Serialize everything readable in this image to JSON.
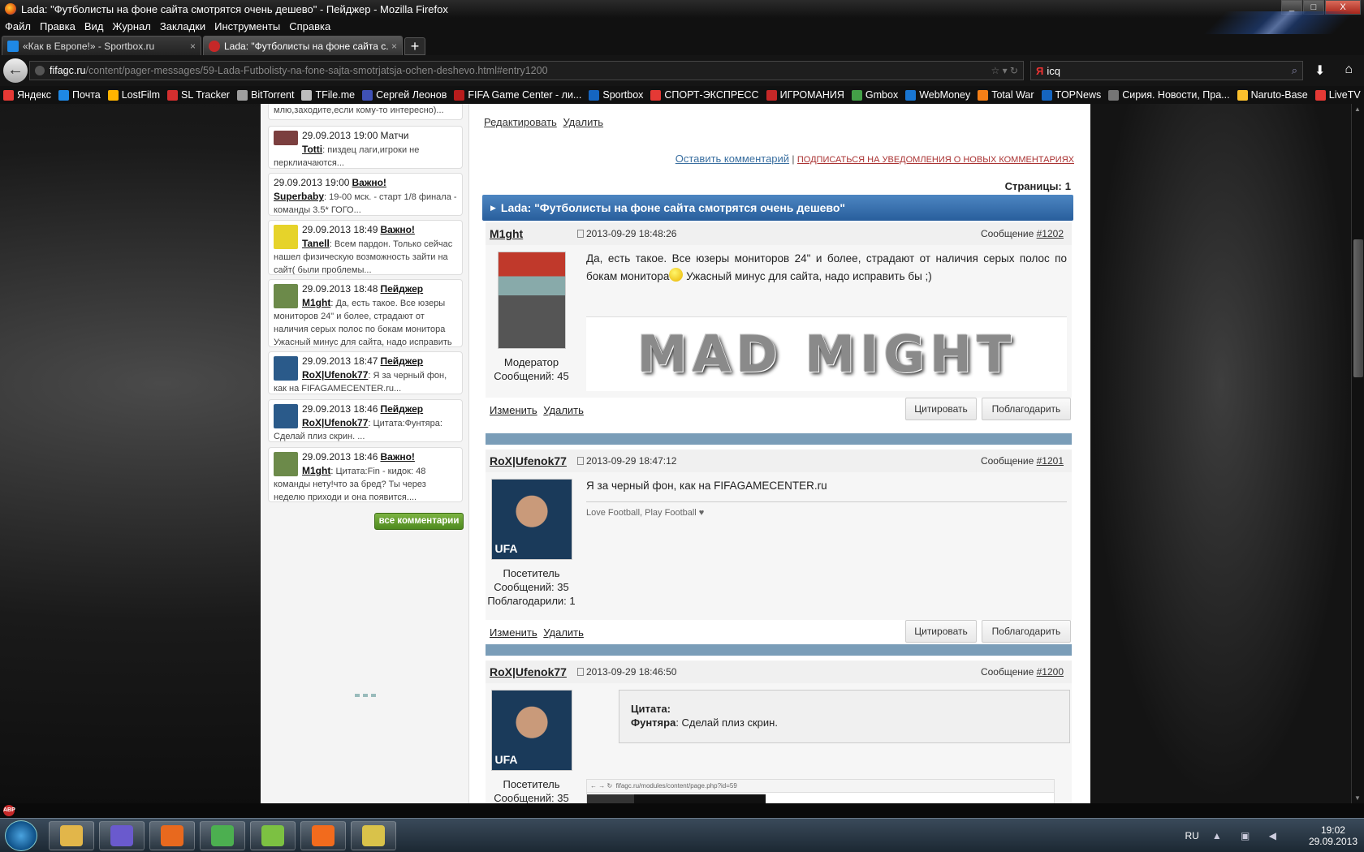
{
  "window": {
    "title": "Lada: \"Футболисты на фоне сайта смотрятся очень дешево\" - Пейджер - Mozilla Firefox",
    "controls": [
      "_",
      "□",
      "X"
    ]
  },
  "menu": [
    "Файл",
    "Правка",
    "Вид",
    "Журнал",
    "Закладки",
    "Инструменты",
    "Справка"
  ],
  "tabs": [
    {
      "label": "«Как в Европе!» - Sportbox.ru",
      "close": "×",
      "icon_color": "#1e88e5"
    },
    {
      "label": "Lada: \"Футболисты на фоне сайта с...",
      "close": "×",
      "icon_color": "#c62828"
    }
  ],
  "new_tab": "+",
  "address": {
    "domain": "fifagc.ru",
    "path": "/content/pager-messages/59-Lada-Futbolisty-na-fone-sajta-smotrjatsja-ochen-deshevo.html#entry1200",
    "controls": "☆ ▾ ↻"
  },
  "search": {
    "engine": "Я",
    "value": "icq",
    "icon": "search-icon"
  },
  "bookmarks": [
    {
      "label": "Яндекс",
      "color": "#e53935"
    },
    {
      "label": "Почта",
      "color": "#1e88e5"
    },
    {
      "label": "LostFilm",
      "color": "#ffb300"
    },
    {
      "label": "SL Tracker",
      "color": "#d32f2f"
    },
    {
      "label": "BitTorrent",
      "color": "#9e9e9e"
    },
    {
      "label": "TFile.me",
      "color": "#bdbdbd"
    },
    {
      "label": "Сергей Леонов",
      "color": "#3f51b5"
    },
    {
      "label": "FIFA Game Center - ли...",
      "color": "#b71c1c"
    },
    {
      "label": "Sportbox",
      "color": "#1565c0"
    },
    {
      "label": "СПОРТ-ЭКСПРЕСС",
      "color": "#e53935"
    },
    {
      "label": "ИГРОМАНИЯ",
      "color": "#c62828"
    },
    {
      "label": "Gmbox",
      "color": "#43a047"
    },
    {
      "label": "WebMoney",
      "color": "#1976d2"
    },
    {
      "label": "Total War",
      "color": "#f57f17"
    },
    {
      "label": "TOPNews",
      "color": "#1565c0"
    },
    {
      "label": "Сирия. Новости, Пра...",
      "color": "#757575"
    },
    {
      "label": "Naruto-Base",
      "color": "#fbc02d"
    },
    {
      "label": "LiveTV",
      "color": "#e53935"
    }
  ],
  "sidebar": {
    "comments": [
      {
        "text": "млю,заходите,если кому-то интересно)..."
      },
      {
        "date": "29.09.2013 19:00",
        "category": "Матчи",
        "author": "Totti",
        "text": "пиздец лаги,игроки не перклиачаются...",
        "avatar_color": "#7b3f3f"
      },
      {
        "date": "29.09.2013 19:00",
        "category": "Важно!",
        "author": "Superbaby",
        "text": "19-00 мск. - старт 1/8 финала - команды 3.5* ГОГО..."
      },
      {
        "date": "29.09.2013 18:49",
        "category": "Важно!",
        "author": "Tanell",
        "text": "Всем пардон. Только сейчас нашел физическую возможность зайти на сайт( были проблемы...",
        "avatar_color": "#e6d32a"
      },
      {
        "date": "29.09.2013 18:48",
        "category": "Пейджер",
        "author": "M1ght",
        "text": "Да, есть такое. Все юзеры мониторов 24\" и более, страдают от наличия серых полос по бокам монитора Ужасный минус для сайта, надо исправить бы ;)...",
        "avatar_color": "#6c8a4a"
      },
      {
        "date": "29.09.2013 18:47",
        "category": "Пейджер",
        "author": "RoX|Ufenok77",
        "text": "Я за черный фон, как на FIFAGAMECENTER.ru...",
        "avatar_color": "#2a5a8a"
      },
      {
        "date": "29.09.2013 18:46",
        "category": "Пейджер",
        "author": "RoX|Ufenok77",
        "text": "Цитата:Фунтяра: Сделай плиз скрин. ...",
        "avatar_color": "#2a5a8a"
      },
      {
        "date": "29.09.2013 18:46",
        "category": "Важно!",
        "author": "M1ght",
        "text": "Цитата:Fin - кидок: 48 команды нету!что за бред? Ты через неделю приходи и она появится....",
        "avatar_color": "#6c8a4a"
      }
    ],
    "all_comments_label": "все комментарии"
  },
  "main": {
    "top_links": [
      "Редактировать",
      "Удалить"
    ],
    "leave_comment": "Оставить комментарий",
    "separator": "|",
    "subscribe": "ПОДПИСАТЬСЯ НА УВЕДОМЛЕНИЯ О НОВЫХ КОММЕНТАРИЯХ",
    "pages_label": "Страницы:",
    "pages_value": "1",
    "thread_title": "Lada: \"Футболисты на фоне сайта смотрятся очень дешево\"",
    "posts": [
      {
        "author": "M1ght",
        "date": "2013-09-29 18:48:26",
        "number_label": "Сообщение",
        "number": "#1202",
        "text_before_smiley": "Да, есть такое. Все юзеры мониторов 24\" и более, страдают от наличия серых полос по бокам монитора",
        "text_after_smiley": " Ужасный минус для сайта, надо исправить бы ;)",
        "signature_text": "MAD MIGHT",
        "role": "Модератор",
        "messages": "Сообщений: 45",
        "actions": [
          "Изменить",
          "Удалить"
        ],
        "buttons": [
          "Цитировать",
          "Поблагодарить"
        ]
      },
      {
        "author": "RoX|Ufenok77",
        "date": "2013-09-29 18:47:12",
        "number_label": "Сообщение",
        "number": "#1201",
        "text": "Я за черный фон, как на FIFAGAMECENTER.ru",
        "signature": "Love Football, Play Football ♥",
        "avatar_text": "UFA",
        "role": "Посетитель",
        "messages": "Сообщений: 35",
        "thanks": "Поблагодарили: 1",
        "actions": [
          "Изменить",
          "Удалить"
        ],
        "buttons": [
          "Цитировать",
          "Поблагодарить"
        ]
      },
      {
        "author": "RoX|Ufenok77",
        "date": "2013-09-29 18:46:50",
        "number_label": "Сообщение",
        "number": "#1200",
        "quote_title": "Цитата:",
        "quote_author": "Фунтяра",
        "quote_text": ": Сделай плиз скрин.",
        "screenshot_url": "fifagc.ru/modules/content/page.php?id=59",
        "avatar_text": "UFA",
        "role": "Посетитель",
        "messages": "Сообщений: 35"
      }
    ]
  },
  "taskbar": {
    "apps": [
      {
        "name": "explorer",
        "color": "#e2b64a"
      },
      {
        "name": "media",
        "color": "#6a5acd"
      },
      {
        "name": "firefox",
        "color": "#e8691e"
      },
      {
        "name": "picasa",
        "color": "#4caf50"
      },
      {
        "name": "icq",
        "color": "#7cc142"
      },
      {
        "name": "origin",
        "color": "#f26b1d"
      },
      {
        "name": "game",
        "color": "#d9c24a"
      }
    ],
    "lang": "RU",
    "tray_icons": "▲ ▣ ◀",
    "time": "19:02",
    "date": "29.09.2013"
  }
}
